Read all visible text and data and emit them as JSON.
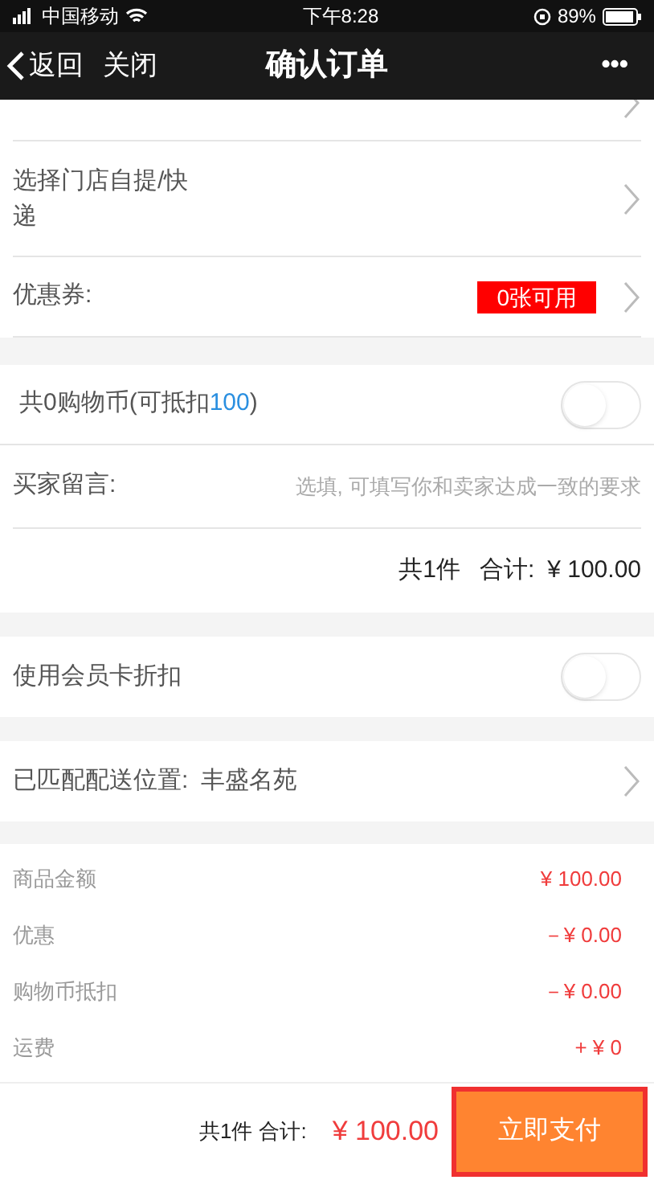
{
  "status_bar": {
    "carrier": "中国移动",
    "time": "下午8:28",
    "battery": "89%"
  },
  "nav": {
    "back": "返回",
    "close": "关闭",
    "title": "确认订单",
    "more": "•••"
  },
  "pickup": {
    "label": "选择门店自提/快递"
  },
  "coupon": {
    "label": "优惠券:",
    "badge": "0张可用"
  },
  "coins": {
    "label": "共0购物币(可抵扣**100**)",
    "on": false
  },
  "message": {
    "label": "买家留言:",
    "placeholder": "选填, 可填写你和卖家达成一致的要求"
  },
  "subtotal": {
    "count": "共1件",
    "label": "合计:",
    "amount": "¥ 100.00"
  },
  "member_card": {
    "label": "使用会员卡折扣",
    "on": false
  },
  "delivery": {
    "label": "已匹配配送位置:",
    "value": "丰盛名苑"
  },
  "summary": [
    {
      "label": "商品金额",
      "value": "¥ 100.00"
    },
    {
      "label": "优惠",
      "value": "－¥ 0.00"
    },
    {
      "label": "购物币抵扣",
      "value": "－¥ 0.00"
    },
    {
      "label": "运费",
      "value": "+ ¥ 0"
    }
  ],
  "footer": {
    "count": "共1件",
    "label": "合计:",
    "amount": "¥ 100.00",
    "pay": "立即支付"
  }
}
